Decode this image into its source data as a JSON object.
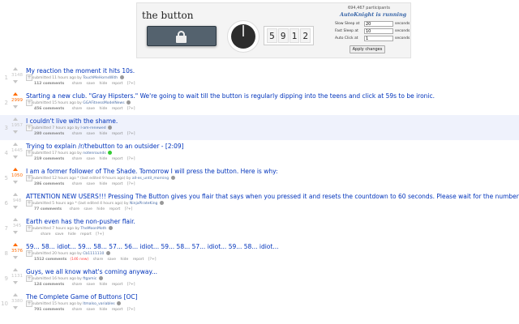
{
  "widget": {
    "title": "the button",
    "timer_digits": [
      "5",
      "9",
      "1",
      "2"
    ],
    "participants": "694,467 participants",
    "status": "AutoKnight is running",
    "settings": [
      {
        "label": "Slow Sleep at",
        "value": "20",
        "unit": "seconds"
      },
      {
        "label": "Fast Sleep at",
        "value": "10",
        "unit": "seconds"
      },
      {
        "label": "Auto Click at",
        "value": "1",
        "unit": "seconds"
      }
    ],
    "apply_label": "Apply changes"
  },
  "posts": [
    {
      "rank": "1",
      "score": "3148",
      "title": "My reaction the moment it hits 10s.",
      "tagline": "submitted 11 hours ago by",
      "author": "TouchMeHornsWith",
      "comments": "112 comments",
      "new": "",
      "highlight": false,
      "voted": false
    },
    {
      "rank": "2",
      "score": "2999",
      "title": "Starting a new club. \"Gray Hipsters.\" We're going to wait till the button is regularly dipping into the teens and click at 59s to be ironic.",
      "tagline": "submitted 15 hours ago by",
      "author": "GGAFitnessModelNews",
      "comments": "456 comments",
      "new": "",
      "highlight": false,
      "voted": true
    },
    {
      "rank": "3",
      "score": "1957",
      "title": "I couldn't live with the shame.",
      "tagline": "submitted 7 hours ago by",
      "author": "I-am-renewed",
      "comments": "280 comments",
      "new": "",
      "highlight": true,
      "voted": false
    },
    {
      "rank": "4",
      "score": "1445",
      "title": "Trying to explain /r/thebutton to an outsider - [2:09]",
      "tagline": "submitted 17 hours ago by",
      "author": "notenrounds",
      "comments": "219 comments",
      "new": "",
      "highlight": false,
      "voted": false,
      "green": true
    },
    {
      "rank": "5",
      "score": "1050",
      "title": "I am a former follower of The Shade. Tomorrow I will press the button. Here is why:",
      "tagline": "submitted 12 hours ago * (last edited 9 hours ago) by",
      "author": "all-es_until_morning",
      "comments": "286 comments",
      "new": "",
      "highlight": false,
      "voted": true
    },
    {
      "rank": "6",
      "score": "948",
      "title": "ATTENTION NEW USERS!!! Pressing The Button gives you flair that says when you pressed it and resets the countdown to 60 seconds. Please wait for the number to drop into single digits. If you're going to press the button, please wait until it is below 40. Thank you.",
      "tagline": "submitted 5 hours ago * (last edited 4 hours ago) by",
      "author": "NinjaPirateKing",
      "comments": "77 comments",
      "new": "",
      "highlight": false,
      "voted": false
    },
    {
      "rank": "7",
      "score": "345",
      "title": "Earth even has the non-pusher flair.",
      "tagline": "submitted 7 hours ago by",
      "author": "TheMoonMoth",
      "comments": "",
      "new": "",
      "highlight": false,
      "voted": false
    },
    {
      "rank": "8",
      "score": "3576",
      "title": "59... 58... idiot... 59... 58... 57... 56... idiot... 59... 58... 57... idiot... 59... 58... idiot...",
      "tagline": "submitted 20 hours ago by",
      "author": "Cb1111110",
      "comments": "1512 comments",
      "new": "(146 new)",
      "highlight": false,
      "voted": true
    },
    {
      "rank": "9",
      "score": "1131",
      "title": "Guys, we all know what's coming anyway...",
      "tagline": "submitted 16 hours ago by",
      "author": "ftgamic",
      "comments": "124 comments",
      "new": "",
      "highlight": false,
      "voted": false
    },
    {
      "rank": "10",
      "score": "3380",
      "title": "The Complete Game of Buttons [OC]",
      "tagline": "submitted 15 hours ago by",
      "author": "Itmalso_variables",
      "comments": "701 comments",
      "new": "",
      "highlight": false,
      "voted": false
    }
  ],
  "actions": {
    "share": "share",
    "save": "save",
    "hide": "hide",
    "report": "report",
    "flair": "[?+]"
  }
}
